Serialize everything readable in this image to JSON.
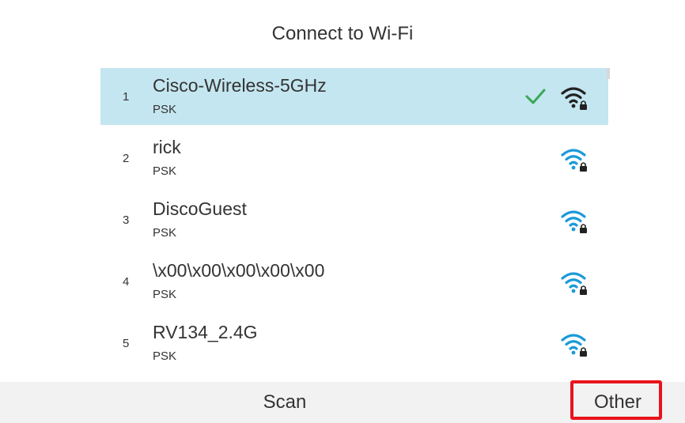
{
  "screen": {
    "title": "Connect to Wi-Fi"
  },
  "networks": [
    {
      "index": "1",
      "ssid": "Cisco-Wireless-5GHz",
      "security": "PSK",
      "selected": true,
      "connected": true
    },
    {
      "index": "2",
      "ssid": "rick",
      "security": "PSK",
      "selected": false,
      "connected": false
    },
    {
      "index": "3",
      "ssid": "DiscoGuest",
      "security": "PSK",
      "selected": false,
      "connected": false
    },
    {
      "index": "4",
      "ssid": "\\x00\\x00\\x00\\x00\\x00",
      "security": "PSK",
      "selected": false,
      "connected": false
    },
    {
      "index": "5",
      "ssid": "RV134_2.4G",
      "security": "PSK",
      "selected": false,
      "connected": false
    }
  ],
  "softkeys": {
    "scan": "Scan",
    "other": "Other"
  },
  "icons": {
    "wifi": "wifi-lock-icon",
    "check": "checkmark-icon"
  },
  "colors": {
    "selected_row": "#c4e6f0",
    "wifi_active": "#222222",
    "wifi_inactive": "#1a9ad9",
    "check": "#3aa757",
    "highlight_border": "#e8141c",
    "footer": "#f2f2f2"
  }
}
